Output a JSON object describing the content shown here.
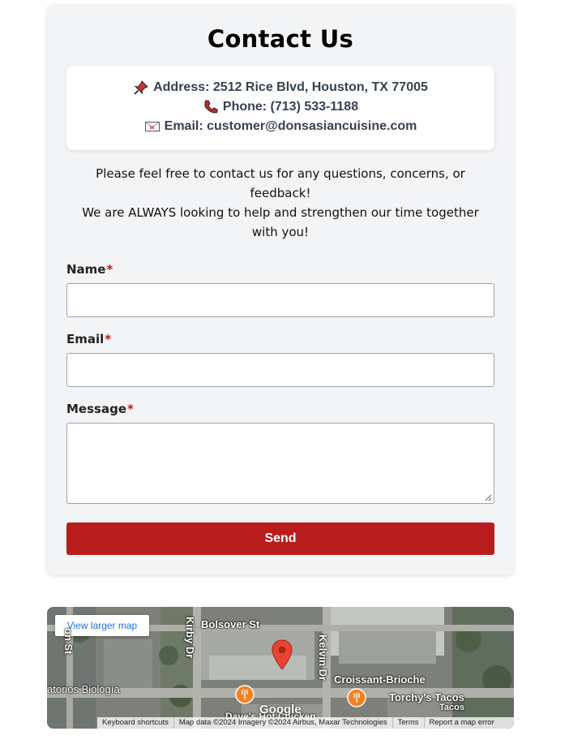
{
  "contact": {
    "title": "Contact Us",
    "address": "Address: 2512 Rice Blvd, Houston, TX 77005",
    "phone": "Phone: (713) 533-1188",
    "email": "Email: customer@donsasiancuisine.com",
    "intro_line1": "Please feel free to contact us for any questions, concerns, or feedback!",
    "intro_line2": "We are ALWAYS looking to help and strengthen our time together with you!"
  },
  "form": {
    "name_label": "Name",
    "email_label": "Email",
    "message_label": "Message",
    "required_mark": "*",
    "name_value": "",
    "email_value": "",
    "message_value": "",
    "send_label": "Send"
  },
  "map": {
    "view_larger": "View larger map",
    "streets": [
      "Bolsover St",
      "Kirby Dr",
      "Kelvin Dr",
      "on St"
    ],
    "places": [
      "Croissant-Brioche",
      "Torchy's Tacos",
      "Tacos",
      "atorios Biología",
      "Dave's Hot Chicken"
    ],
    "logo": "Google",
    "attribution": [
      "Keyboard shortcuts",
      "Map data ©2024 Imagery ©2024 Airbus, Maxar Technologies",
      "Terms",
      "Report a map error"
    ]
  },
  "colors": {
    "accent": "#b91c1c",
    "card_bg": "#f3f4f6",
    "text_info": "#374151",
    "link": "#1a73e8"
  },
  "icons": [
    "pushpin-icon",
    "phone-icon",
    "envelope-icon",
    "map-pin-icon",
    "restaurant-icon"
  ]
}
